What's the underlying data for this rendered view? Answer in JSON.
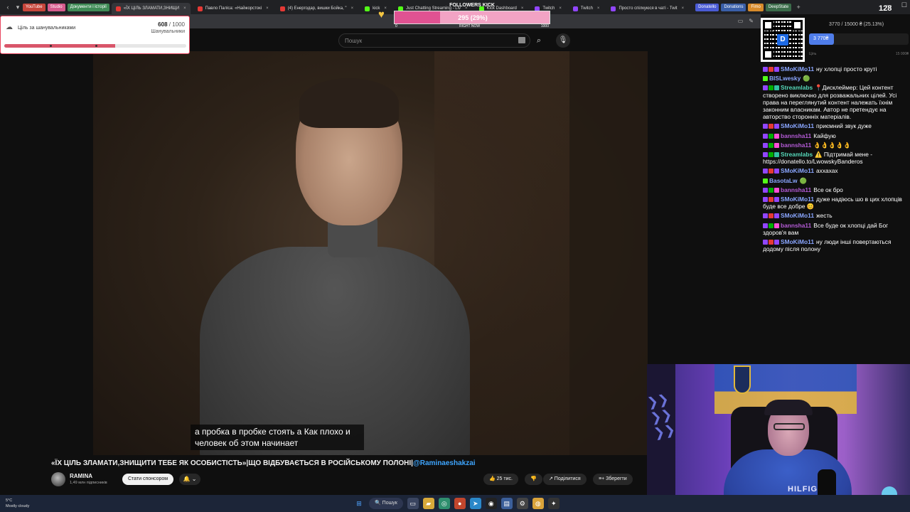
{
  "browser": {
    "bookmarks": [
      {
        "label": "YouTube",
        "color": "#c7463b"
      },
      {
        "label": "Studio",
        "color": "#d65b8d"
      },
      {
        "label": "Документи і історії",
        "color": "#3f8b56"
      }
    ],
    "tabs": [
      {
        "label": "«ЇХ ЦІЛЬ ЗЛАМАТИ,ЗНИЩИ",
        "favicon": "#e53935",
        "active": true
      },
      {
        "label": "Павло Паліса: «Найжорстокі",
        "favicon": "#e53935"
      },
      {
        "label": "(4) Енергодар, вишки Бойка, \"",
        "favicon": "#e53935"
      },
      {
        "label": "kick",
        "favicon": "#53fc18"
      },
      {
        "label": "Just Chatting Streaming - Liv",
        "favicon": "#53fc18"
      },
      {
        "label": "Kick Dashboard",
        "favicon": "#53fc18"
      },
      {
        "label": "Twitch",
        "favicon": "#9146ff"
      },
      {
        "label": "Twitch",
        "favicon": "#9146ff"
      },
      {
        "label": "Просто спілкуюся в чаті - Twit",
        "favicon": "#9146ff"
      }
    ],
    "bookmarks_right": [
      {
        "label": "Donatello",
        "color": "#4a5bd4"
      },
      {
        "label": "Donations",
        "color": "#3a5fa8"
      },
      {
        "label": "Fimo",
        "color": "#d88b2b"
      },
      {
        "label": "DeepState",
        "color": "#3b6c4a"
      }
    ],
    "view_count": "128"
  },
  "youtube": {
    "search_placeholder": "Пошук",
    "subtitles": "а пробка в пробке стоять а Как плохо и человек об этом начинает",
    "title_main": "«ЇХ ЦІЛЬ ЗЛАМАТИ,ЗНИЩИТИ ТЕБЕ ЯК ОСОБИСТІСТЬ»|ЩО ВІДБУВАЄТЬСЯ В РОСІЙСЬКОМУ ПОЛОНІ|",
    "title_tag": "@Raminaeshakzai",
    "channel_name": "RAMINA",
    "channel_subs": "1,49 млн підписників",
    "sponsor_label": "Стати спонсором",
    "bell_label": "🔔 ⌄",
    "like_label": "👍 25 тис.",
    "dislike_label": "👎",
    "share_label": "↗ Поділитися",
    "save_label": "Зберегти"
  },
  "goal_widget": {
    "label": "Ціль за шанувальниками",
    "current": "608",
    "total": " / 1000",
    "sub": "Шанувальники",
    "progress": 0.608
  },
  "kick_overlay": {
    "title": "FOLLOWERS KICK",
    "value_text": "295 (29%)",
    "progress": 0.295,
    "min_label": "0",
    "mid_label": "RIGHT NOW",
    "max_label": "1000"
  },
  "donation_goal": {
    "text": "3770 / 15000 ₴ (25.13%)",
    "bar_label": "3 770₴",
    "progress": 0.2513,
    "min_label": "Ціль",
    "max_label": "15 000₴"
  },
  "chat": [
    {
      "badges": [
        "b-tw",
        "b-yt",
        "b-tw"
      ],
      "nick": "SMoKiMo11",
      "color": "#8aa6ff",
      "text": "ну хлопці просто круті"
    },
    {
      "badges": [
        "b-kick"
      ],
      "nick": "BISLwesky",
      "color": "#8aa6ff",
      "text": "🟢"
    },
    {
      "badges": [
        "b-tw",
        "b-mod",
        "b-st"
      ],
      "nick": "Streamlabs",
      "color": "#55d6b8",
      "text": "📍Дисклеймер: Цей контент створено виключно для розважальних цілей. Усі права на переглянутий контент належать їхнім законним власникам. Автор не претендує на авторство сторонніх матеріалів."
    },
    {
      "badges": [
        "b-tw",
        "b-yt",
        "b-tw"
      ],
      "nick": "SMoKiMo11",
      "color": "#8aa6ff",
      "text": "приємний звук дуже"
    },
    {
      "badges": [
        "b-tw",
        "b-mod",
        "b-sub"
      ],
      "nick": "bannsha11",
      "color": "#b45bd6",
      "text": "Кайфую"
    },
    {
      "badges": [
        "b-tw",
        "b-mod",
        "b-sub"
      ],
      "nick": "bannsha11",
      "color": "#b45bd6",
      "text": "👌👌👌👌👌"
    },
    {
      "badges": [
        "b-tw",
        "b-mod",
        "b-st"
      ],
      "nick": "Streamlabs",
      "color": "#55d6b8",
      "text": "⚠️ Підтримай мене - https://donatello.to/LwowskyBanderos"
    },
    {
      "badges": [
        "b-tw",
        "b-yt",
        "b-tw"
      ],
      "nick": "SMoKiMo11",
      "color": "#8aa6ff",
      "text": "аххахах"
    },
    {
      "badges": [
        "b-kick"
      ],
      "nick": "BasotaLw",
      "color": "#8aa6ff",
      "text": "🟢"
    },
    {
      "badges": [
        "b-tw",
        "b-mod",
        "b-sub"
      ],
      "nick": "bannsha11",
      "color": "#b45bd6",
      "text": "Все ок бро"
    },
    {
      "badges": [
        "b-tw",
        "b-yt",
        "b-tw"
      ],
      "nick": "SMoKiMo11",
      "color": "#8aa6ff",
      "text": "дуже надіюсь шо в цих хлопців буде все добре 😊"
    },
    {
      "badges": [
        "b-tw",
        "b-yt",
        "b-tw"
      ],
      "nick": "SMoKiMo11",
      "color": "#8aa6ff",
      "text": "жесть"
    },
    {
      "badges": [
        "b-tw",
        "b-mod",
        "b-sub"
      ],
      "nick": "bannsha11",
      "color": "#b45bd6",
      "text": "Все буде ок хлопці дай Бог здоров'я вам"
    },
    {
      "badges": [
        "b-tw",
        "b-yt",
        "b-tw"
      ],
      "nick": "SMoKiMo11",
      "color": "#8aa6ff",
      "text": "ну люди інші повертаються додому після полону"
    }
  ],
  "webcam": {
    "shirt_text": "HILFIGER"
  },
  "taskbar": {
    "weather_temp": "5°C",
    "weather_desc": "Mostly cloudy",
    "search_label": "🔍 Пошук"
  }
}
